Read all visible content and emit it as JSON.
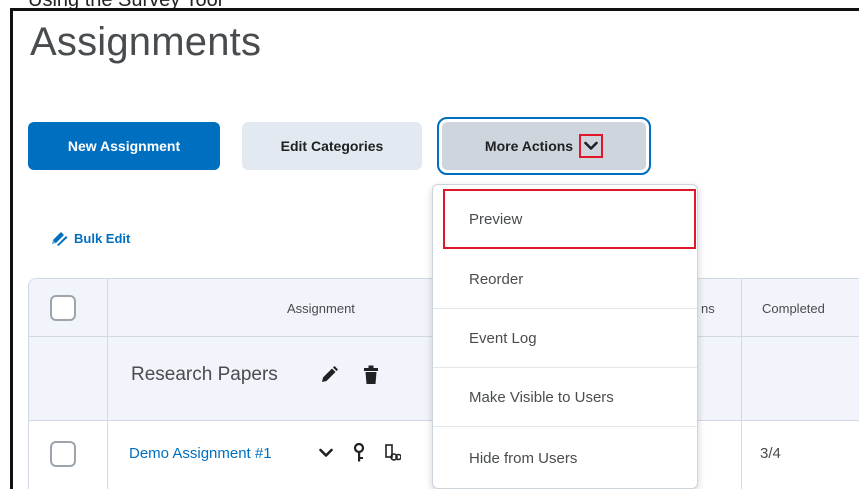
{
  "page": {
    "title": "Assignments",
    "clipped_heading": "Using the Survey Tool"
  },
  "toolbar": {
    "new_assignment": "New Assignment",
    "edit_categories": "Edit Categories",
    "more_actions": "More Actions"
  },
  "bulk_edit": {
    "label": "Bulk Edit"
  },
  "table": {
    "columns": [
      "Assignment",
      "ns",
      "Completed"
    ],
    "category": {
      "name": "Research Papers"
    },
    "rows": [
      {
        "name": "Demo Assignment #1",
        "completed": "3/4"
      }
    ]
  },
  "menu": {
    "items": [
      {
        "label": "Preview",
        "highlighted": true
      },
      {
        "label": "Reorder"
      },
      {
        "label": "Event Log"
      },
      {
        "label": "Make Visible to Users"
      },
      {
        "label": "Hide from Users"
      }
    ]
  },
  "colors": {
    "primary": "#006fbf",
    "highlight": "#e0162b",
    "secondary_bg": "#e3e9f1",
    "header_bg": "#f1f5fb"
  },
  "icons": [
    "chevron-down-icon",
    "bulk-edit-icon",
    "pencil-icon",
    "trash-icon",
    "key-icon",
    "rubric-icon"
  ]
}
